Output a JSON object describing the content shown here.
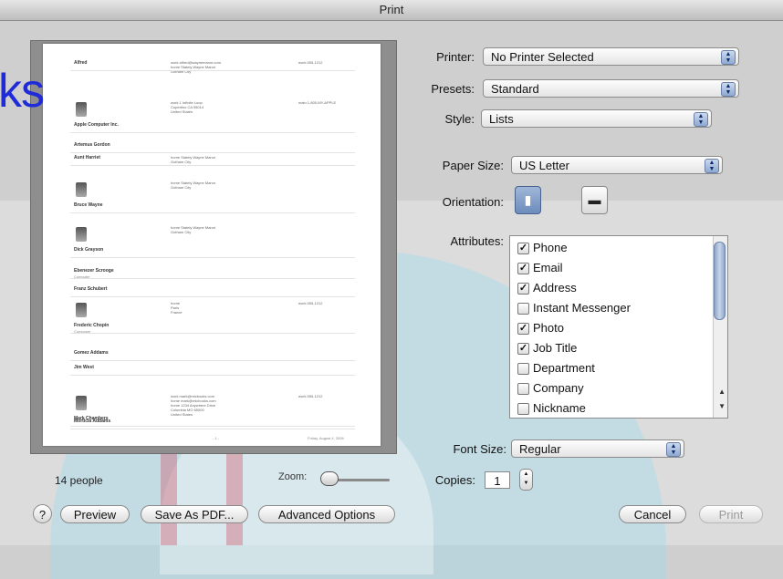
{
  "window": {
    "title": "Print"
  },
  "watermark_text": "ks",
  "preview": {
    "people_count": "14 people",
    "zoom_label": "Zoom:",
    "contacts": [
      {
        "name": "Alfred",
        "sub": "",
        "address": "work  alfred@waynemanor.com\nhome  Stately Wayne Manor\nGotham City",
        "phone": "work  555-1212",
        "photo": false
      },
      {
        "name": "Apple Computer Inc.",
        "sub": "",
        "address": "work  1 Infinite Loop\nCupertino CA 95014\nUnited States",
        "phone": "main  1-800-MY-APPLE",
        "photo": true
      },
      {
        "name": "Artemus Gordon",
        "sub": "",
        "address": "",
        "phone": "",
        "photo": false
      },
      {
        "name": "Aunt Harriet",
        "sub": "",
        "address": "home  Stately Wayne Manor\nGotham City",
        "phone": "",
        "photo": false
      },
      {
        "name": "Bruce Wayne",
        "sub": "",
        "address": "home  Stately Wayne Manor\nGotham City",
        "phone": "",
        "photo": true
      },
      {
        "name": "Dick Grayson",
        "sub": "",
        "address": "home  Stately Wayne Manor\nGotham City",
        "phone": "",
        "photo": true
      },
      {
        "name": "Ebenezer Scrooge",
        "sub": "Computer",
        "address": "",
        "phone": "",
        "photo": false
      },
      {
        "name": "Franz Schubert",
        "sub": "",
        "address": "",
        "phone": "",
        "photo": false
      },
      {
        "name": "Frederic Chopin",
        "sub": "Composer",
        "address": "home\nParis\nFrance",
        "phone": "work  555-1212",
        "photo": true
      },
      {
        "name": "Gomez Addams",
        "sub": "",
        "address": "",
        "phone": "",
        "photo": false
      },
      {
        "name": "Jim West",
        "sub": "",
        "address": "",
        "phone": "",
        "photo": false
      },
      {
        "name": "Mark Chambers",
        "sub": "",
        "address": "work  mark@mlcbooks.com\nhome  mark@mlcbooks.com\nhome  1234 Anywhere Drive\nColumbia MO 65000\nUnited States",
        "phone": "work  555-1212",
        "photo": true
      },
      {
        "name": "Morticia Addams",
        "sub": "",
        "address": "",
        "phone": "",
        "photo": false
      }
    ],
    "footer": "Friday, August 4, 2006",
    "page_marker": "- 1 -"
  },
  "settings": {
    "printer_label": "Printer:",
    "printer_value": "No Printer Selected",
    "presets_label": "Presets:",
    "presets_value": "Standard",
    "style_label": "Style:",
    "style_value": "Lists",
    "paper_size_label": "Paper Size:",
    "paper_size_value": "US Letter",
    "orientation_label": "Orientation:",
    "attributes_label": "Attributes:",
    "attributes": [
      {
        "label": "Phone",
        "checked": true
      },
      {
        "label": "Email",
        "checked": true
      },
      {
        "label": "Address",
        "checked": true
      },
      {
        "label": "Instant Messenger",
        "checked": false
      },
      {
        "label": "Photo",
        "checked": true
      },
      {
        "label": "Job Title",
        "checked": true
      },
      {
        "label": "Department",
        "checked": false
      },
      {
        "label": "Company",
        "checked": false
      },
      {
        "label": "Nickname",
        "checked": false
      }
    ],
    "font_size_label": "Font Size:",
    "font_size_value": "Regular",
    "copies_label": "Copies:",
    "copies_value": "1"
  },
  "buttons": {
    "help": "?",
    "preview": "Preview",
    "save_pdf": "Save As PDF...",
    "advanced": "Advanced Options",
    "cancel": "Cancel",
    "print": "Print"
  }
}
